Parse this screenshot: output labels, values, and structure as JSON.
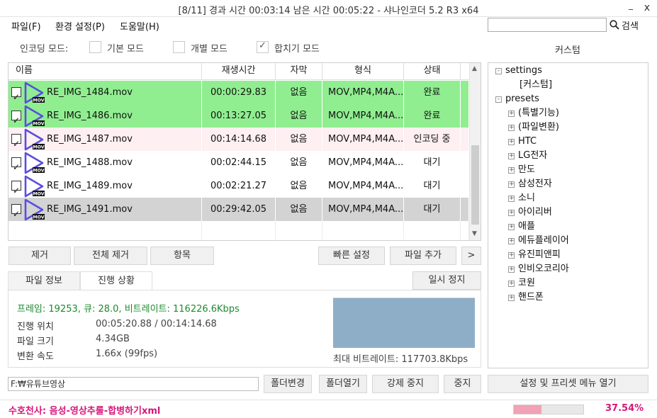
{
  "window": {
    "title": "[8/11]  경과 시간  00:03:14   남은 시간  00:05:22  -  샤나인코더  5.2  R3  x64",
    "minimize_label": "_",
    "close_label": "x"
  },
  "menu": {
    "items": [
      {
        "label": "파일(F)"
      },
      {
        "label": "환경 설정(P)"
      },
      {
        "label": "도움말(H)"
      }
    ],
    "search_value": "",
    "search_label": "검색"
  },
  "encoding_mode": {
    "label": "인코딩 모드:",
    "options": [
      {
        "label": "기본 모드",
        "checked": false
      },
      {
        "label": "개별 모드",
        "checked": false
      },
      {
        "label": "합치기 모드",
        "checked": true
      }
    ]
  },
  "custom_header": "커스텀",
  "table": {
    "columns": [
      "이름",
      "재생시간",
      "자막",
      "형식",
      "상태"
    ],
    "rows": [
      {
        "name": "RE_IMG_1484.mov",
        "duration": "00:00:29.83",
        "subtitle": "없음",
        "format": "MOV,MP4,M4A...",
        "status": "완료",
        "row_color": "#90ee90"
      },
      {
        "name": "RE_IMG_1486.mov",
        "duration": "00:13:27.05",
        "subtitle": "없음",
        "format": "MOV,MP4,M4A...",
        "status": "완료",
        "row_color": "#90ee90"
      },
      {
        "name": "RE_IMG_1487.mov",
        "duration": "00:14:14.68",
        "subtitle": "없음",
        "format": "MOV,MP4,M4A...",
        "status": "인코딩 중",
        "row_color": "#fdeff2"
      },
      {
        "name": "RE_IMG_1488.mov",
        "duration": "00:02:44.15",
        "subtitle": "없음",
        "format": "MOV,MP4,M4A...",
        "status": "대기",
        "row_color": "#ffffff"
      },
      {
        "name": "RE_IMG_1489.mov",
        "duration": "00:02:21.27",
        "subtitle": "없음",
        "format": "MOV,MP4,M4A...",
        "status": "대기",
        "row_color": "#ffffff"
      },
      {
        "name": "RE_IMG_1491.mov",
        "duration": "00:29:42.05",
        "subtitle": "없음",
        "format": "MOV,MP4,M4A...",
        "status": "대기",
        "row_color": "#d3d3d3"
      }
    ],
    "icon_badge": "MOV"
  },
  "tree": {
    "items": [
      {
        "label": "settings",
        "level": 0,
        "toggle": "-"
      },
      {
        "label": "[커스텀]",
        "level": 1,
        "toggle": ""
      },
      {
        "label": "presets",
        "level": 0,
        "toggle": "-"
      },
      {
        "label": "(특별기능)",
        "level": 1,
        "toggle": "+"
      },
      {
        "label": "(파일변환)",
        "level": 1,
        "toggle": "+"
      },
      {
        "label": "HTC",
        "level": 1,
        "toggle": "+"
      },
      {
        "label": "LG전자",
        "level": 1,
        "toggle": "+"
      },
      {
        "label": "만도",
        "level": 1,
        "toggle": "+"
      },
      {
        "label": "삼성전자",
        "level": 1,
        "toggle": "+"
      },
      {
        "label": "소니",
        "level": 1,
        "toggle": "+"
      },
      {
        "label": "아이리버",
        "level": 1,
        "toggle": "+"
      },
      {
        "label": "애플",
        "level": 1,
        "toggle": "+"
      },
      {
        "label": "에듀플레이어",
        "level": 1,
        "toggle": "+"
      },
      {
        "label": "유진피앤피",
        "level": 1,
        "toggle": "+"
      },
      {
        "label": "인비오코리아",
        "level": 1,
        "toggle": "+"
      },
      {
        "label": "코원",
        "level": 1,
        "toggle": "+"
      },
      {
        "label": "핸드폰",
        "level": 1,
        "toggle": "+"
      }
    ]
  },
  "buttons": {
    "remove": "제거",
    "remove_all": "전체 제거",
    "items": "항목",
    "quick_settings": "빠른 설정",
    "add_file": "파일 추가",
    "more": ">",
    "pause": "일시 정지",
    "change_folder": "폴더변경",
    "open_folder": "폴더열기",
    "force_stop": "강제 중지",
    "stop": "중지",
    "open_settings_menu": "설정 및 프리셋 메뉴 열기"
  },
  "tabs": {
    "file_info": "파일 정보",
    "progress": "진행 상황"
  },
  "progress_info": {
    "frame_line": "프레임: 19253, 큐: 28.0, 비트레이트: 116226.6Kbps",
    "position_label": "진행 위치",
    "position_value": "00:05:20.88 / 00:14:14.68",
    "filesize_label": "파일 크기",
    "filesize_value": "4.34GB",
    "speed_label": "변환 속도",
    "speed_value": "1.66x (99fps)",
    "max_bitrate": "최대 비트레이트: 117703.8Kbps"
  },
  "folder_path": "F:₩유튜브영상",
  "status": {
    "text": "수호천사: 음성-영상추룰-합병하기xml",
    "percent_label": "37.54%",
    "progress_fraction": 0.4,
    "accent_color": "#d6177a"
  }
}
